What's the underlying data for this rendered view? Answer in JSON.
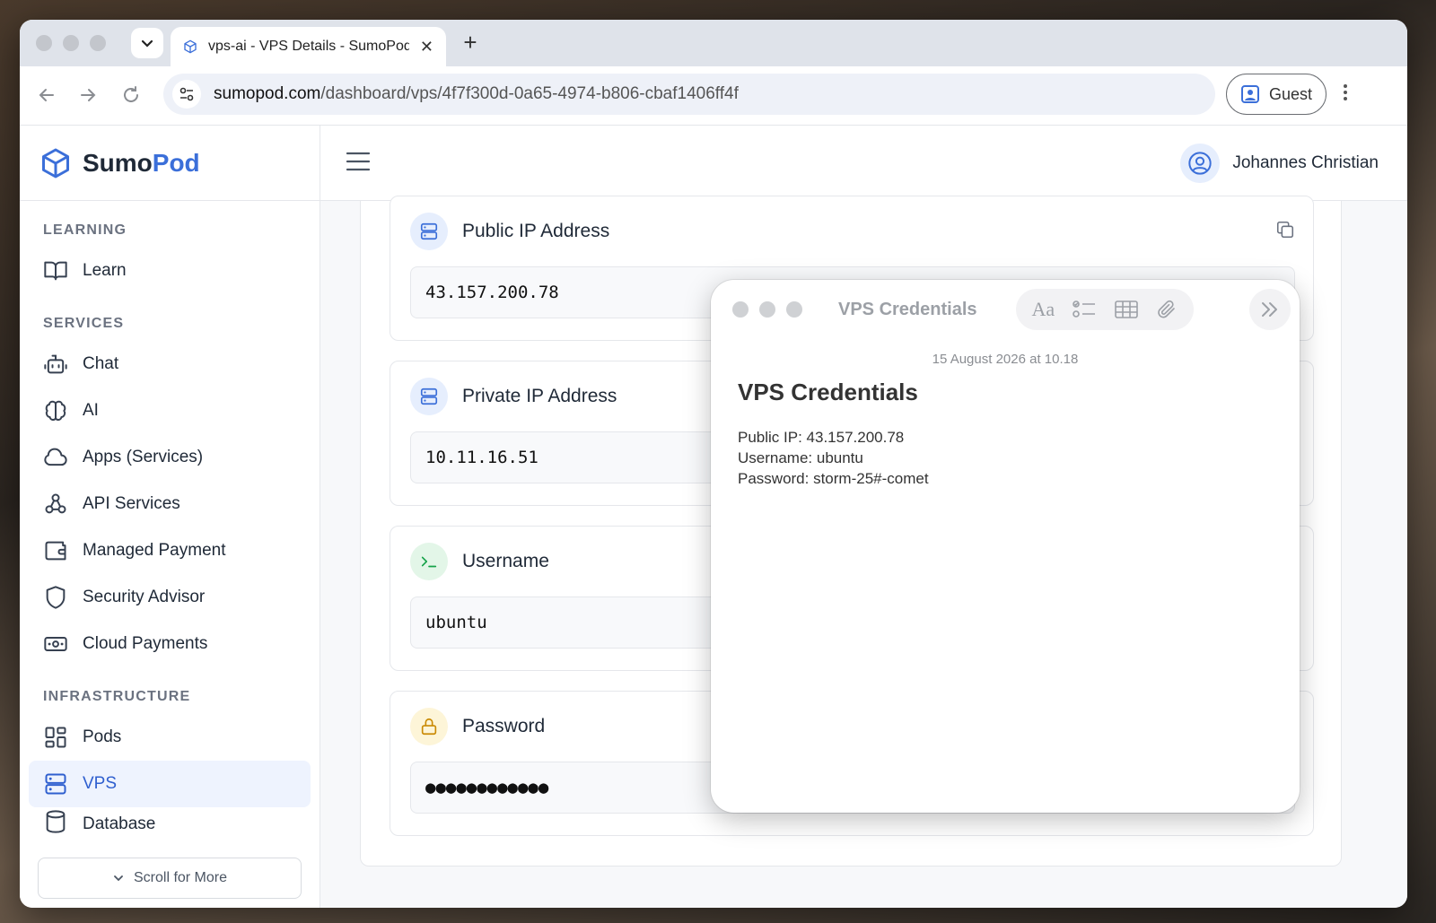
{
  "browser": {
    "tab_title": "vps-ai - VPS Details - SumoPod",
    "new_tab_symbol": "+",
    "url_domain": "sumopod.com",
    "url_path": "/dashboard/vps/4f7f300d-0a65-4974-b806-cbaf1406ff4f",
    "profile_label": "Guest"
  },
  "brand": {
    "name_part1": "Sumo",
    "name_part2": "Pod"
  },
  "sidebar": {
    "sections": [
      {
        "title": "LEARNING",
        "items": [
          {
            "label": "Learn",
            "icon": "book-icon"
          }
        ]
      },
      {
        "title": "SERVICES",
        "items": [
          {
            "label": "Chat",
            "icon": "robot-icon"
          },
          {
            "label": "AI",
            "icon": "brain-icon"
          },
          {
            "label": "Apps (Services)",
            "icon": "cloud-icon"
          },
          {
            "label": "API Services",
            "icon": "webhook-icon"
          },
          {
            "label": "Managed Payment",
            "icon": "wallet-icon"
          },
          {
            "label": "Security Advisor",
            "icon": "shield-icon"
          },
          {
            "label": "Cloud Payments",
            "icon": "banknote-icon"
          }
        ]
      },
      {
        "title": "INFRASTRUCTURE",
        "items": [
          {
            "label": "Pods",
            "icon": "grid-icon"
          },
          {
            "label": "VPS",
            "icon": "server-icon",
            "active": true
          },
          {
            "label": "Database",
            "icon": "database-icon"
          }
        ]
      }
    ],
    "scroll_more": "Scroll for More"
  },
  "header": {
    "user_name": "Johannes Christian"
  },
  "fields": [
    {
      "label": "Public IP Address",
      "value": "43.157.200.78",
      "icon": "server-icon",
      "color": "#3b6fd9"
    },
    {
      "label": "Private IP Address",
      "value": "10.11.16.51",
      "icon": "server-icon",
      "color": "#3b6fd9"
    },
    {
      "label": "Username",
      "value": "ubuntu",
      "icon": "terminal-icon",
      "color": "#16a34a"
    },
    {
      "label": "Password",
      "value": "●●●●●●●●●●●●",
      "icon": "lock-icon",
      "color": "#ca8a04"
    }
  ],
  "notes": {
    "window_title": "VPS Credentials",
    "date": "15 August 2026 at 10.18",
    "heading": "VPS Credentials",
    "lines": [
      "Public IP: 43.157.200.78",
      "Username: ubuntu",
      "Password: storm-25#-comet"
    ]
  }
}
